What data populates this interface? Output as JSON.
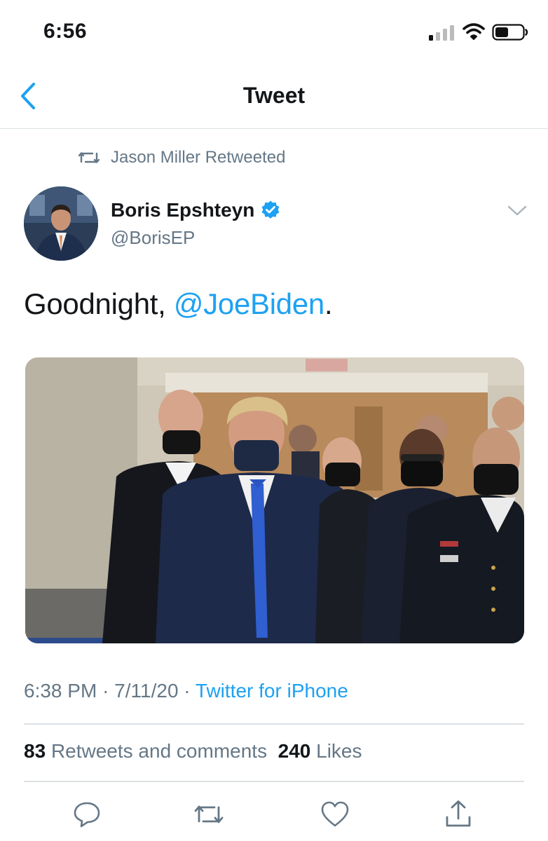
{
  "status_bar": {
    "time": "6:56",
    "icons": [
      "cellular-signal-icon",
      "wifi-icon",
      "battery-icon"
    ]
  },
  "nav": {
    "back_icon": "chevron-left-icon",
    "title": "Tweet"
  },
  "tweet": {
    "retweeted_by": "Jason Miller Retweeted",
    "author": {
      "name": "Boris Epshteyn",
      "handle": "@BorisEP",
      "verified": true
    },
    "text_before": "Goodnight, ",
    "mention": "@JoeBiden",
    "text_after": ".",
    "time": "6:38 PM",
    "date": "7/11/20",
    "separator": "·",
    "source": "Twitter for iPhone",
    "stats": {
      "retweets_count": "83",
      "retweets_label": "Retweets and comments",
      "likes_count": "240",
      "likes_label": "Likes"
    }
  },
  "actions": [
    "reply-icon",
    "retweet-icon",
    "like-icon",
    "share-icon"
  ],
  "colors": {
    "accent": "#1da1f2",
    "secondary_text": "#657786",
    "primary_text": "#14171a",
    "divider": "#dde1e4"
  }
}
